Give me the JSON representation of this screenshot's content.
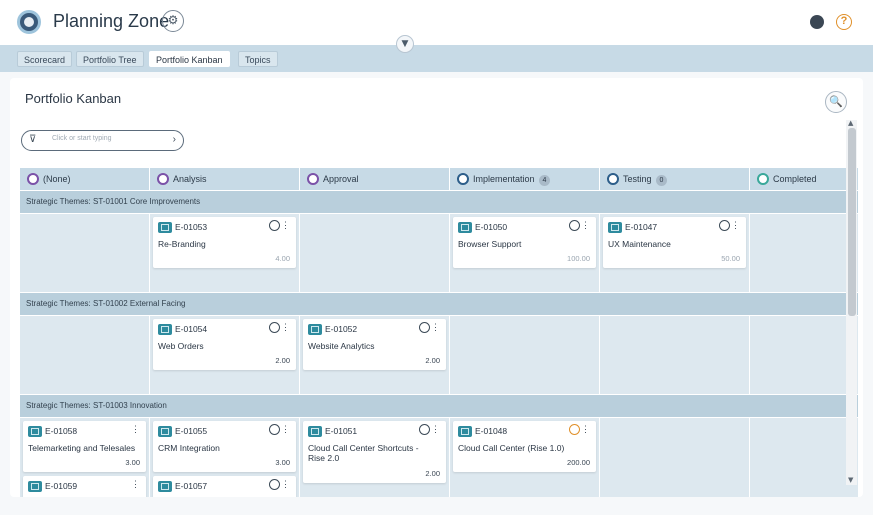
{
  "header": {
    "title": "Planning Zone",
    "settings_icon": "gear-icon",
    "help_glyph": "?"
  },
  "tabs": [
    {
      "label": "Scorecard",
      "active": false
    },
    {
      "label": "Portfolio Tree",
      "active": false
    },
    {
      "label": "Portfolio Kanban",
      "active": true
    },
    {
      "label": "Topics",
      "active": false
    }
  ],
  "panel": {
    "title": "Portfolio Kanban",
    "filter_placeholder": "Click or start typing"
  },
  "columns": [
    {
      "label": "(None)",
      "count": "",
      "ring_color": "#7b52a8"
    },
    {
      "label": "Analysis",
      "count": "",
      "ring_color": "#7b52a8"
    },
    {
      "label": "Approval",
      "count": "",
      "ring_color": "#7b52a8"
    },
    {
      "label": "Implementation",
      "count": "4",
      "ring_color": "#2d5e8a"
    },
    {
      "label": "Testing",
      "count": "0",
      "ring_color": "#2d5e8a"
    },
    {
      "label": "Completed",
      "count": "",
      "ring_color": "#3aa89a"
    }
  ],
  "swimlanes": [
    {
      "label": "Strategic Themes: ST-01001 Core Improvements"
    },
    {
      "label": "Strategic Themes: ST-01002 External Facing"
    },
    {
      "label": "Strategic Themes: ST-01003 Innovation"
    }
  ],
  "cards": {
    "e01053": {
      "id": "E-01053",
      "name": "Re-Branding",
      "points": "4.00"
    },
    "e01050": {
      "id": "E-01050",
      "name": "Browser Support",
      "points": "100.00"
    },
    "e01047": {
      "id": "E-01047",
      "name": "UX Maintenance",
      "points": "50.00"
    },
    "e01054": {
      "id": "E-01054",
      "name": "Web Orders",
      "points": "2.00"
    },
    "e01052": {
      "id": "E-01052",
      "name": "Website Analytics",
      "points": "2.00"
    },
    "e01058": {
      "id": "E-01058",
      "name": "Telemarketing and Telesales",
      "points": "3.00"
    },
    "e01055": {
      "id": "E-01055",
      "name": "CRM Integration",
      "points": "3.00"
    },
    "e01051": {
      "id": "E-01051",
      "name": "Cloud Call Center Shortcuts - Rise 2.0",
      "points": "2.00"
    },
    "e01048": {
      "id": "E-01048",
      "name": "Cloud Call Center (Rise 1.0)",
      "points": "200.00"
    },
    "e01059": {
      "id": "E-01059"
    },
    "e01057": {
      "id": "E-01057"
    }
  }
}
